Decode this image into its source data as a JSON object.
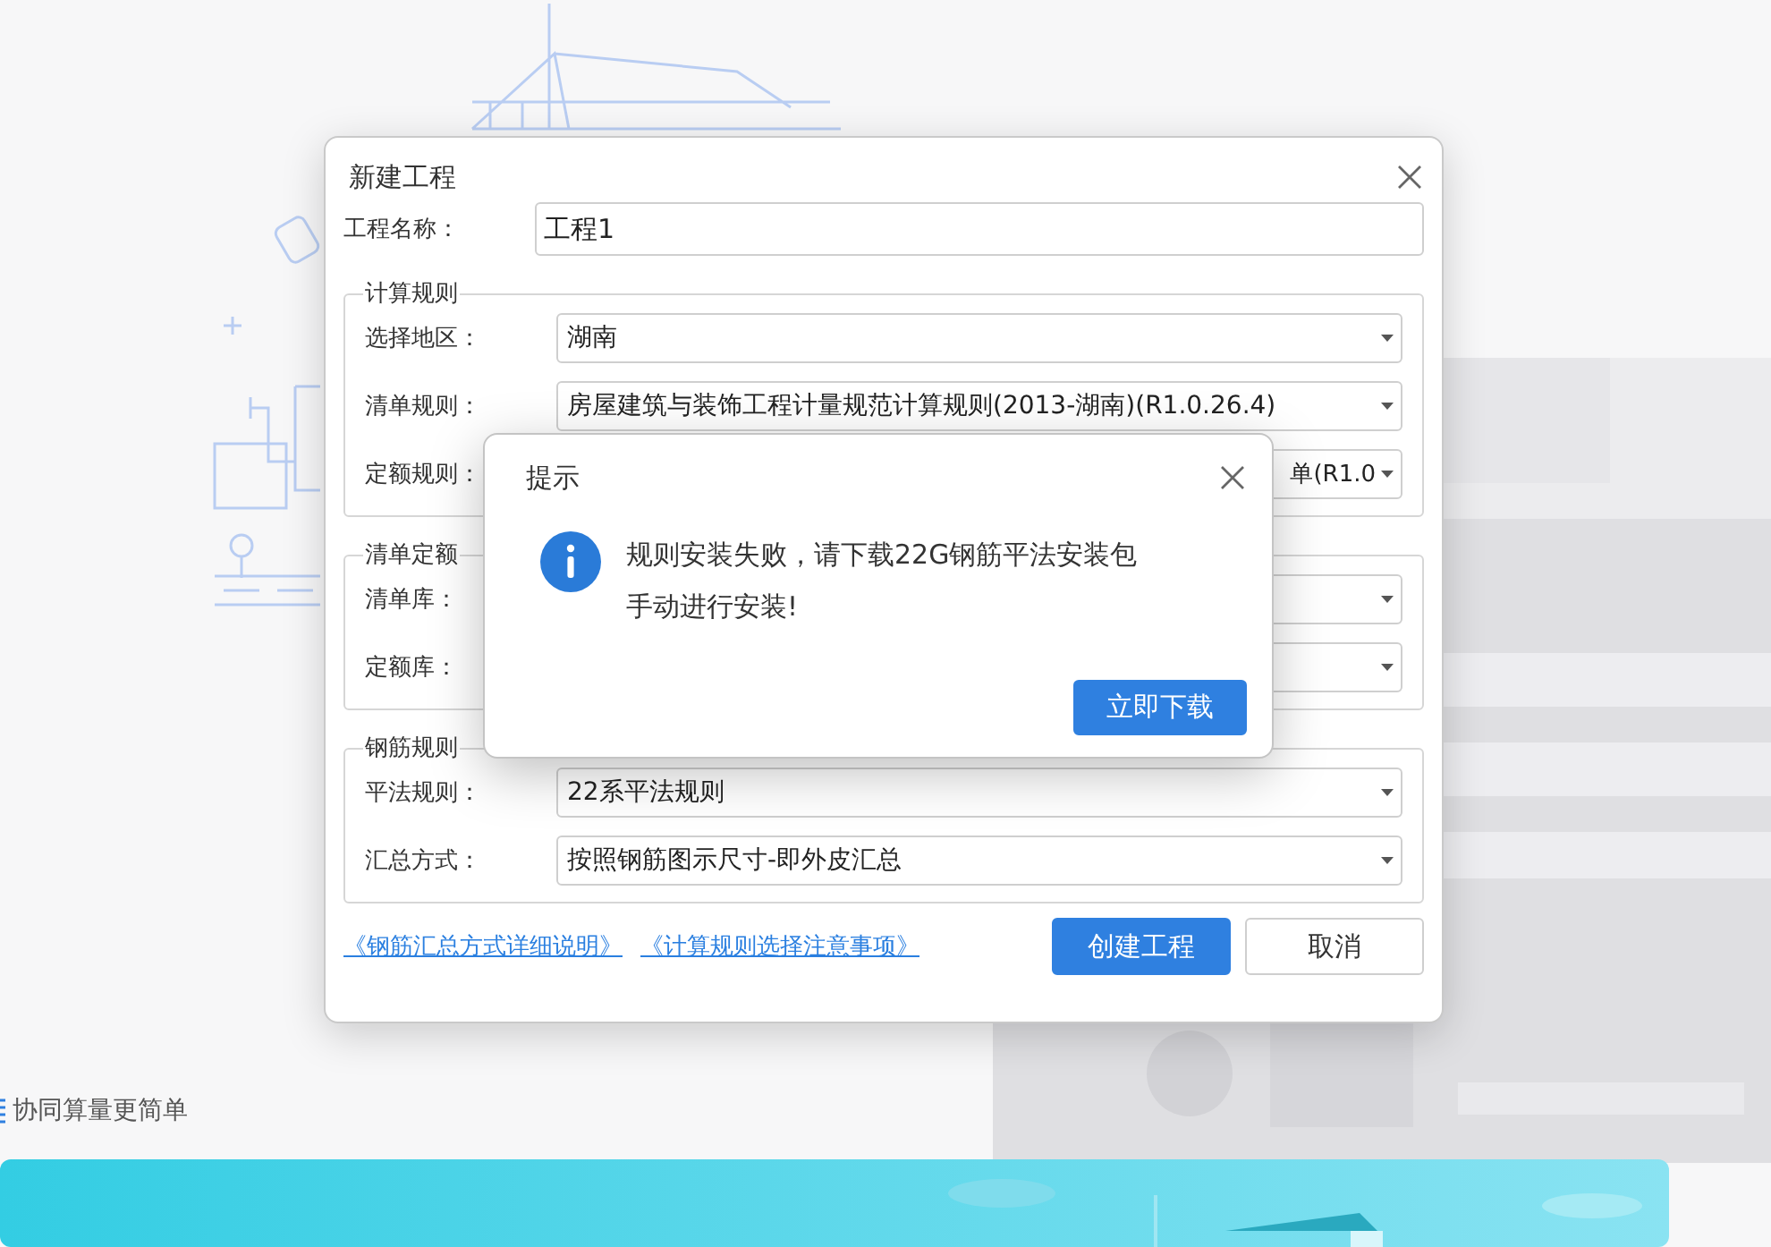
{
  "dialog": {
    "title": "新建工程",
    "name_field": {
      "label": "工程名称：",
      "value": "工程1"
    },
    "groups": [
      {
        "legend": "计算规则",
        "fields": [
          {
            "label": "选择地区：",
            "value": "湖南"
          },
          {
            "label": "清单规则：",
            "value": "房屋建筑与装饰工程计量规范计算规则(2013-湖南)(R1.0.26.4)"
          },
          {
            "label": "定额规则：",
            "value": "单(R1.0",
            "clipped": true
          }
        ]
      },
      {
        "legend": "清单定额",
        "fields": [
          {
            "label": "清单库："
          },
          {
            "label": "定额库："
          }
        ]
      },
      {
        "legend": "钢筋规则",
        "fields": [
          {
            "label": "平法规则：",
            "value": "22系平法规则"
          },
          {
            "label": "汇总方式：",
            "value": "按照钢筋图示尺寸-即外皮汇总"
          }
        ]
      }
    ],
    "links": [
      "《钢筋汇总方式详细说明》",
      "《计算规则选择注意事项》"
    ],
    "buttons": [
      {
        "label": "创建工程",
        "kind": "primary"
      },
      {
        "label": "取消",
        "kind": "default"
      }
    ]
  },
  "alert": {
    "title": "提示",
    "message_lines": [
      "规则安装失败，请下载22G钢筋平法安装包",
      "手动进行安装!"
    ],
    "button": "立即下载"
  },
  "background": {
    "tagline": "协同算量更简单"
  }
}
